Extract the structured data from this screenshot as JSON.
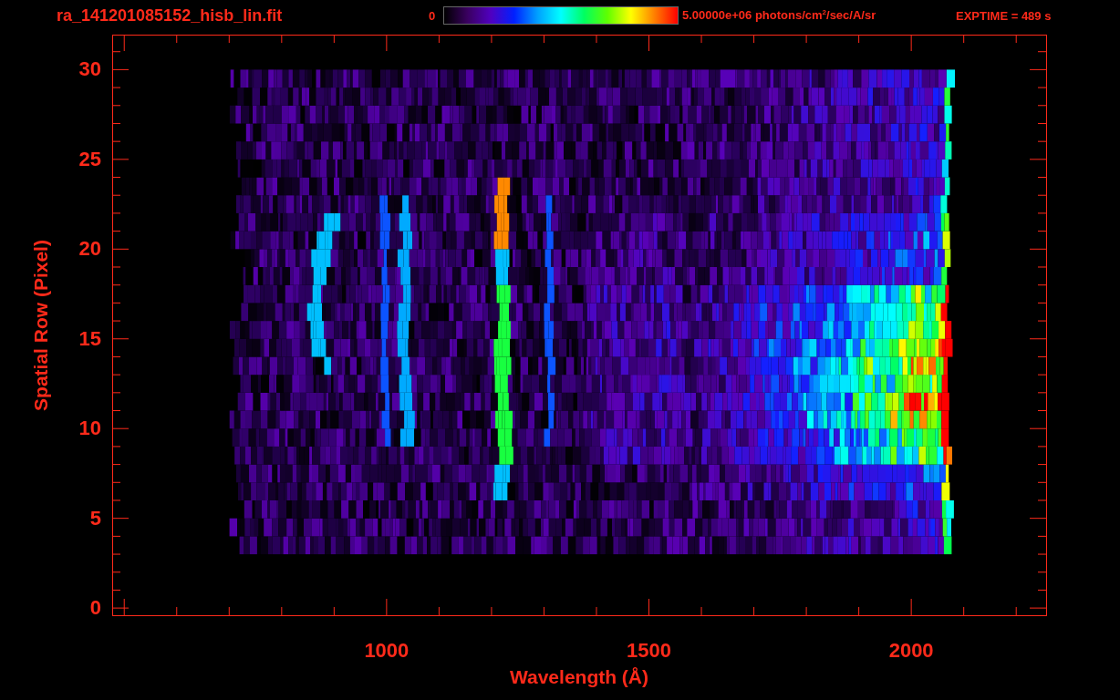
{
  "header": {
    "filename": "ra_141201085152_hisb_lin.fit",
    "colorbar_min": "0",
    "colorbar_max": "5.00000e+06 photons/cm$^{2}$/sec/A/sr",
    "exptime": "EXPTIME = 489 s"
  },
  "plot": {
    "xlabel": "Wavelength (Å)",
    "ylabel": "Spatial Row (Pixel)",
    "xticks": [
      "1000",
      "1500",
      "2000"
    ],
    "yticks": [
      "30",
      "25",
      "20",
      "15",
      "10",
      "5",
      "0"
    ]
  }
}
